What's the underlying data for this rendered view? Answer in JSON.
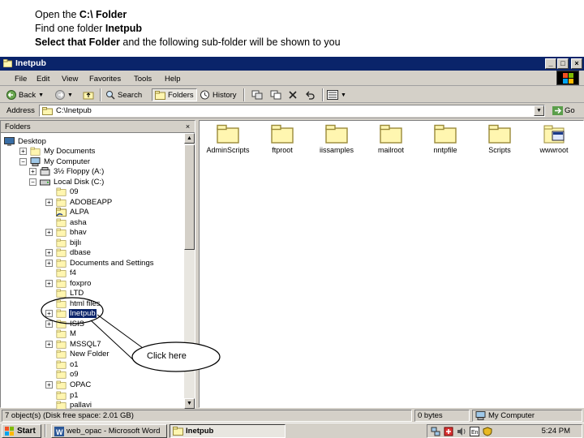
{
  "instructions": {
    "line1_prefix": "Open the ",
    "line1_bold": "C:\\ Folder",
    "line2_prefix": "Find one folder ",
    "line2_bold": "Inetpub",
    "line3_bold": "Select that Folder",
    "line3_suffix": " and the following sub-folder will be shown to you"
  },
  "window": {
    "title": "Inetpub",
    "minimize": "_",
    "maximize": "□",
    "close": "×"
  },
  "menu": [
    "File",
    "Edit",
    "View",
    "Favorites",
    "Tools",
    "Help"
  ],
  "toolbar": {
    "back": "Back",
    "search": "Search",
    "folders": "Folders",
    "history": "History"
  },
  "address": {
    "label": "Address",
    "value": "C:\\Inetpub",
    "go": "Go"
  },
  "folders_pane": {
    "title": "Folders",
    "close": "×",
    "tree": [
      {
        "label": "Desktop",
        "depth": 0,
        "icon": "desktop-icon"
      },
      {
        "label": "My Documents",
        "depth": 1,
        "icon": "folder-icon",
        "expander": "+"
      },
      {
        "label": "My Computer",
        "depth": 1,
        "icon": "computer-icon",
        "expander": "−"
      },
      {
        "label": "3½ Floppy (A:)",
        "depth": 2,
        "icon": "floppy-icon",
        "expander": "+"
      },
      {
        "label": "Local Disk (C:)",
        "depth": 2,
        "icon": "drive-icon",
        "expander": "−"
      },
      {
        "label": "09",
        "depth": 3,
        "icon": "folder-icon"
      },
      {
        "label": "ADOBEAPP",
        "depth": 3,
        "icon": "folder-icon",
        "expander": "+"
      },
      {
        "label": "ALPA",
        "depth": 3,
        "icon": "shared-folder-icon"
      },
      {
        "label": "asha",
        "depth": 3,
        "icon": "folder-icon"
      },
      {
        "label": "bhav",
        "depth": 3,
        "icon": "folder-icon",
        "expander": "+"
      },
      {
        "label": "bijlı",
        "depth": 3,
        "icon": "folder-icon"
      },
      {
        "label": "dbase",
        "depth": 3,
        "icon": "folder-icon",
        "expander": "+"
      },
      {
        "label": "Documents and Settings",
        "depth": 3,
        "icon": "folder-icon",
        "expander": "+"
      },
      {
        "label": "f4",
        "depth": 3,
        "icon": "folder-icon"
      },
      {
        "label": "foxpro",
        "depth": 3,
        "icon": "folder-icon",
        "expander": "+"
      },
      {
        "label": "LTD",
        "depth": 3,
        "icon": "folder-icon"
      },
      {
        "label": "html files",
        "depth": 3,
        "icon": "folder-icon"
      },
      {
        "label": "Inetpub",
        "depth": 3,
        "icon": "folder-icon",
        "expander": "+",
        "selected": true
      },
      {
        "label": "ISIS",
        "depth": 3,
        "icon": "folder-icon",
        "expander": "+"
      },
      {
        "label": "M",
        "depth": 3,
        "icon": "folder-icon"
      },
      {
        "label": "MSSQL7",
        "depth": 3,
        "icon": "folder-icon",
        "expander": "+"
      },
      {
        "label": "New Folder",
        "depth": 3,
        "icon": "folder-icon"
      },
      {
        "label": "o1",
        "depth": 3,
        "icon": "folder-icon"
      },
      {
        "label": "o9",
        "depth": 3,
        "icon": "folder-icon"
      },
      {
        "label": "OPAC",
        "depth": 3,
        "icon": "folder-icon",
        "expander": "+"
      },
      {
        "label": "p1",
        "depth": 3,
        "icon": "folder-icon"
      },
      {
        "label": "pallavi",
        "depth": 3,
        "icon": "folder-icon"
      }
    ]
  },
  "content": {
    "items": [
      {
        "name": "AdminScripts",
        "icon": "folder-icon"
      },
      {
        "name": "ftproot",
        "icon": "folder-icon"
      },
      {
        "name": "iissamples",
        "icon": "folder-icon"
      },
      {
        "name": "mailroot",
        "icon": "folder-icon"
      },
      {
        "name": "nntpfile",
        "icon": "folder-icon"
      },
      {
        "name": "Scripts",
        "icon": "folder-icon"
      },
      {
        "name": "wwwroot",
        "icon": "web-folder-icon"
      }
    ]
  },
  "status": {
    "objects": "7 object(s) (Disk free space: 2.01 GB)",
    "size": "0 bytes",
    "location": "My Computer"
  },
  "taskbar": {
    "start": "Start",
    "tasks": [
      {
        "label": "web_opac - Microsoft Word",
        "icon": "word-icon",
        "active": false
      },
      {
        "label": "Inetpub",
        "icon": "folder-icon",
        "active": true
      }
    ],
    "clock": "5:24 PM"
  },
  "annotation": {
    "callout_text": "Click here"
  },
  "colors": {
    "titlebar": "#0a246a",
    "chrome": "#d4d0c8",
    "folder_fill": "#fff6b0",
    "folder_stroke": "#9a8a3a",
    "selection": "#0a246a"
  }
}
